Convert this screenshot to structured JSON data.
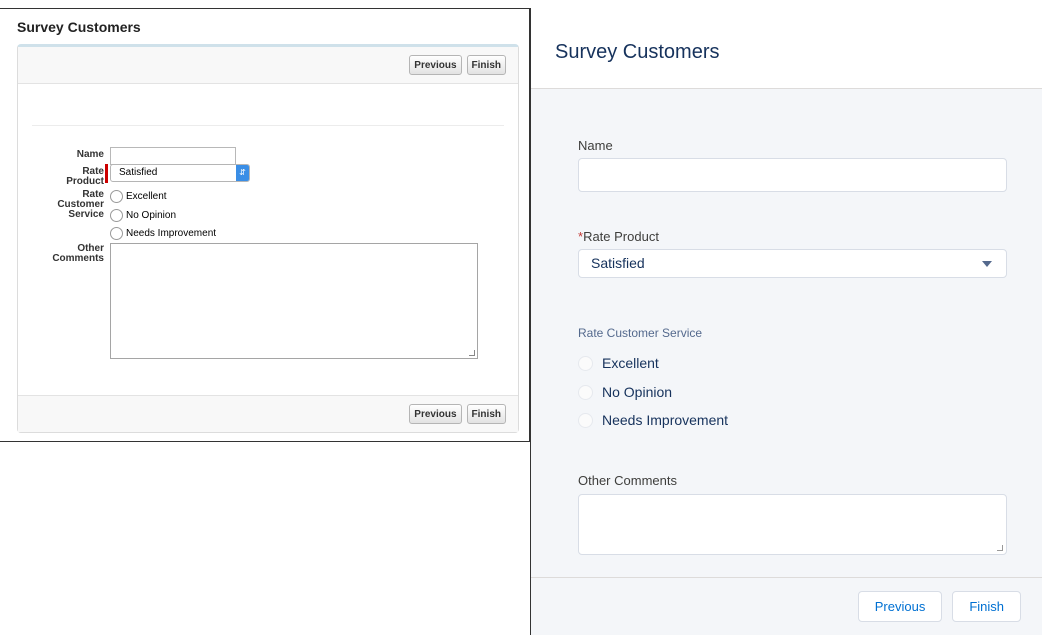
{
  "classic": {
    "title": "Survey Customers",
    "buttons": {
      "previous": "Previous",
      "finish": "Finish"
    },
    "fields": {
      "name_label": "Name",
      "rate_product_label_1": "Rate",
      "rate_product_label_2": "Product",
      "rate_product_value": "Satisfied",
      "rate_service_label_1": "Rate",
      "rate_service_label_2": "Customer",
      "rate_service_label_3": "Service",
      "options": [
        "Excellent",
        "No Opinion",
        "Needs Improvement"
      ],
      "comments_label_1": "Other",
      "comments_label_2": "Comments"
    }
  },
  "lightning": {
    "title": "Survey Customers",
    "fields": {
      "name_label": "Name",
      "required_marker": "*",
      "rate_product_label": "Rate Product",
      "rate_product_value": "Satisfied",
      "rate_service_label": "Rate Customer Service",
      "options": [
        "Excellent",
        "No Opinion",
        "Needs Improvement"
      ],
      "comments_label": "Other Comments"
    },
    "buttons": {
      "previous": "Previous",
      "finish": "Finish"
    }
  }
}
